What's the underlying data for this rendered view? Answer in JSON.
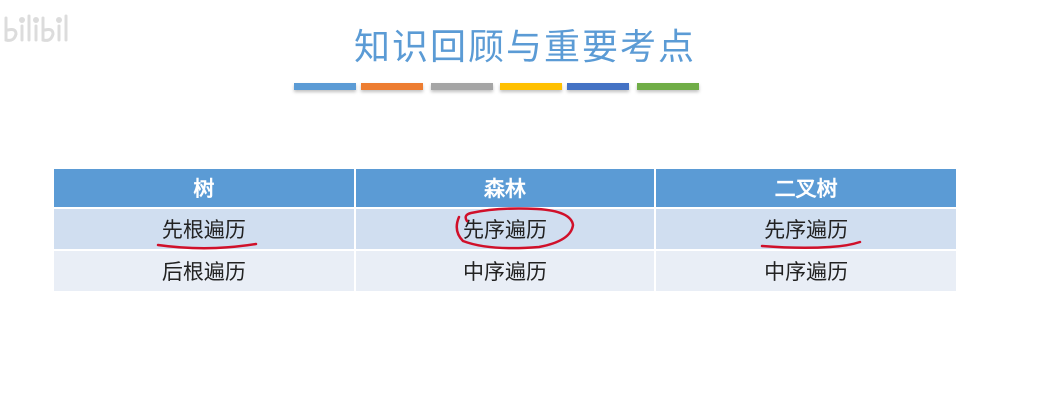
{
  "watermark": {
    "text": "bilibili",
    "icon": "bilibili-logo"
  },
  "slide": {
    "title": "知识回顾与重要考点",
    "accent_bars": [
      "#5b9bd5",
      "#ed7d31",
      "#a5a5a5",
      "#ffc000",
      "#4472c4",
      "#70ad47"
    ]
  },
  "table": {
    "headers": [
      "树",
      "森林",
      "二叉树"
    ],
    "rows": [
      [
        "先根遍历",
        "先序遍历",
        "先序遍历"
      ],
      [
        "后根遍历",
        "中序遍历",
        "中序遍历"
      ]
    ]
  },
  "annotations": {
    "ink_color": "#d0102a",
    "marks": [
      "underline under 先根遍历",
      "circle around 森林 先序遍历",
      "underline under 二叉树 先序遍历"
    ]
  }
}
